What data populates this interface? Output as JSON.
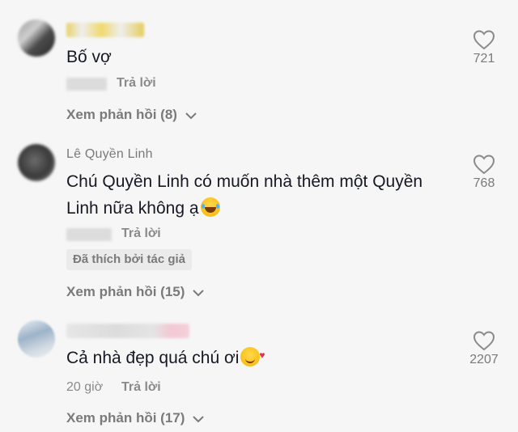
{
  "comments": [
    {
      "username": "",
      "text": "Bố vợ",
      "time": "",
      "reply_label": "Trả lời",
      "liked_by_author": "",
      "view_replies": "Xem phản hồi (8)",
      "likes": "721"
    },
    {
      "username": "Lê Quyền Linh",
      "text_line1": "Chú Quyền Linh có muốn nhà thêm một Quyền",
      "text_line2": "Linh nữa không ạ",
      "time": "",
      "reply_label": "Trả lời",
      "liked_by_author": "Đã thích bởi tác giả",
      "view_replies": "Xem phản hồi (15)",
      "likes": "768"
    },
    {
      "username": "",
      "text": "Cả nhà đẹp quá chú ơi",
      "time": "20 giờ",
      "reply_label": "Trả lời",
      "liked_by_author": "",
      "view_replies": "Xem phản hồi (17)",
      "likes": "2207"
    }
  ],
  "icons": {
    "like": "heart-outline-icon",
    "expand": "chevron-down-icon",
    "emoji_laugh": "tears-of-joy-emoji",
    "emoji_love": "smiling-face-with-hearts-emoji"
  },
  "colors": {
    "background": "#f6f6f6",
    "text": "#161823",
    "muted": "#7a7a7a"
  }
}
